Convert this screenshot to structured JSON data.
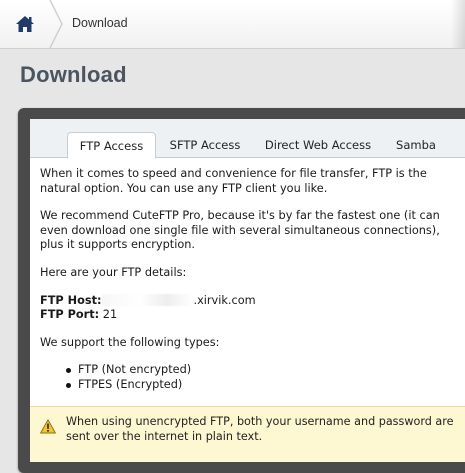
{
  "breadcrumb": {
    "home_icon": "home-icon",
    "current": "Download"
  },
  "page": {
    "title": "Download"
  },
  "tabs": [
    {
      "label": "FTP Access",
      "active": true
    },
    {
      "label": "SFTP Access",
      "active": false
    },
    {
      "label": "Direct Web Access",
      "active": false
    },
    {
      "label": "Samba",
      "active": false
    }
  ],
  "content": {
    "intro": "When it comes to speed and convenience for file transfer, FTP is the natural option. You can use any FTP client you like.",
    "recommend": "We recommend CuteFTP Pro, because it's by far the fastest one (it can even download one single file with several simultaneous connections), plus it supports encryption.",
    "details_heading": "Here are your FTP details:",
    "host_label": "FTP Host:",
    "host_suffix": ".xirvik.com",
    "port_label": "FTP Port:",
    "port_value": "21",
    "types_heading": "We support the following types:",
    "types": [
      "FTP (Not encrypted)",
      "FTPES (Encrypted)"
    ]
  },
  "warning": {
    "icon": "warning-icon",
    "text": "When using unencrypted FTP, both your username and password are sent over the internet in plain text.",
    "color": "#fdf7d2"
  }
}
